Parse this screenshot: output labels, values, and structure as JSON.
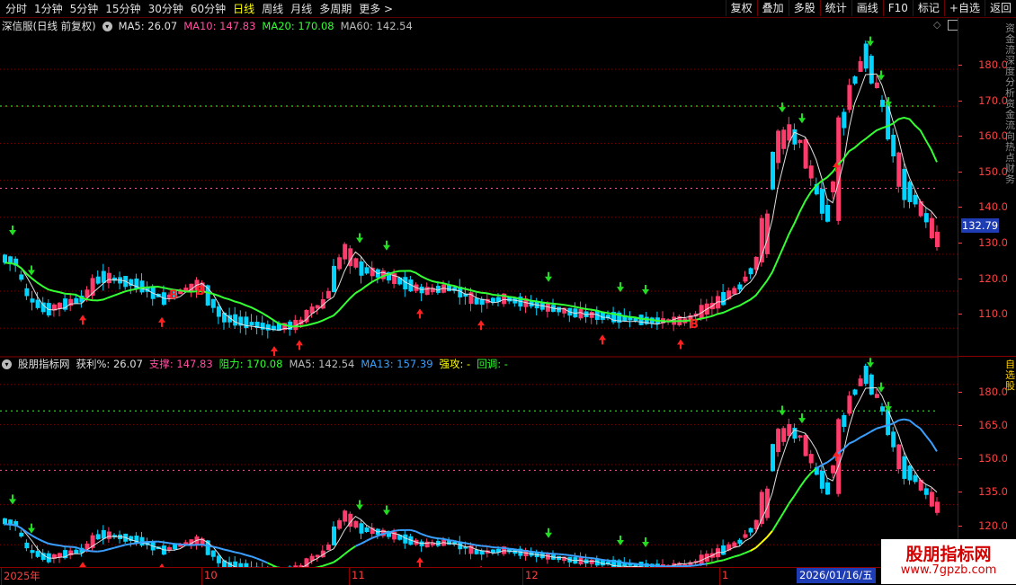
{
  "toolbar": {
    "tabs": [
      "分时",
      "1分钟",
      "5分钟",
      "15分钟",
      "30分钟",
      "60分钟",
      "日线",
      "周线",
      "月线",
      "多周期",
      "更多 >"
    ],
    "active_tab": "日线",
    "right_buttons": [
      "复权",
      "叠加",
      "多股",
      "统计",
      "画线",
      "F10",
      "标记",
      "+自选",
      "返回"
    ]
  },
  "main_panel": {
    "title": "深信服(日线 前复权)",
    "indicators": [
      {
        "label": "MA5: 26.07",
        "color": "#e0e0e0"
      },
      {
        "label": "MA10: 147.83",
        "color": "#ff4fa0"
      },
      {
        "label": "MA20: 170.08",
        "color": "#33ff33"
      },
      {
        "label": "MA60: 142.54",
        "color": "#bbbbbb"
      }
    ],
    "y_ticks": [
      "180.0",
      "170.0",
      "160.0",
      "150.0",
      "140.0",
      "130.0",
      "120.0",
      "110.0"
    ],
    "current_price": "132.79",
    "side_text": "资金流深度分析资金流向热点财务"
  },
  "sub_panel": {
    "title": "股朋指标网",
    "indicators": [
      {
        "label": "获利%: 26.07",
        "color": "#e0e0e0"
      },
      {
        "label": "支撑: 147.83",
        "color": "#ff4fa0"
      },
      {
        "label": "阻力: 170.08",
        "color": "#33ff33"
      },
      {
        "label": "MA5: 142.54",
        "color": "#bbbbbb"
      },
      {
        "label": "MA13: 157.39",
        "color": "#3aa0ff"
      },
      {
        "label": "强攻: -",
        "color": "#ffff00"
      },
      {
        "label": "回调: -",
        "color": "#33ff33"
      }
    ],
    "y_ticks": [
      "180.0",
      "165.0",
      "150.0",
      "135.0",
      "120.0"
    ],
    "side_text": "自选股"
  },
  "x_axis": {
    "labels": [
      "2025年",
      "10",
      "11",
      "12",
      "1"
    ],
    "current_date": "2026/01/16/五"
  },
  "watermark": {
    "title": "股朋指标网",
    "url": "www.7gpzb.com"
  },
  "colors": {
    "up": "#ff3b6b",
    "down": "#00d4ff",
    "ma_green": "#33ff33",
    "ma_white": "#e0e0e0",
    "grid_red": "#8a0000"
  },
  "chart_data": {
    "type": "candlestick",
    "main_y_range": [
      103,
      190
    ],
    "sub_y_range": [
      112,
      190
    ],
    "reference_lines": {
      "support": 147.83,
      "resistance": 170.08
    },
    "series": [
      {
        "name": "MA5",
        "values": [
          26.07
        ]
      },
      {
        "name": "MA10",
        "values": [
          147.83
        ]
      },
      {
        "name": "MA20",
        "values": [
          170.08
        ]
      },
      {
        "name": "MA60",
        "values": [
          142.54
        ]
      }
    ]
  }
}
